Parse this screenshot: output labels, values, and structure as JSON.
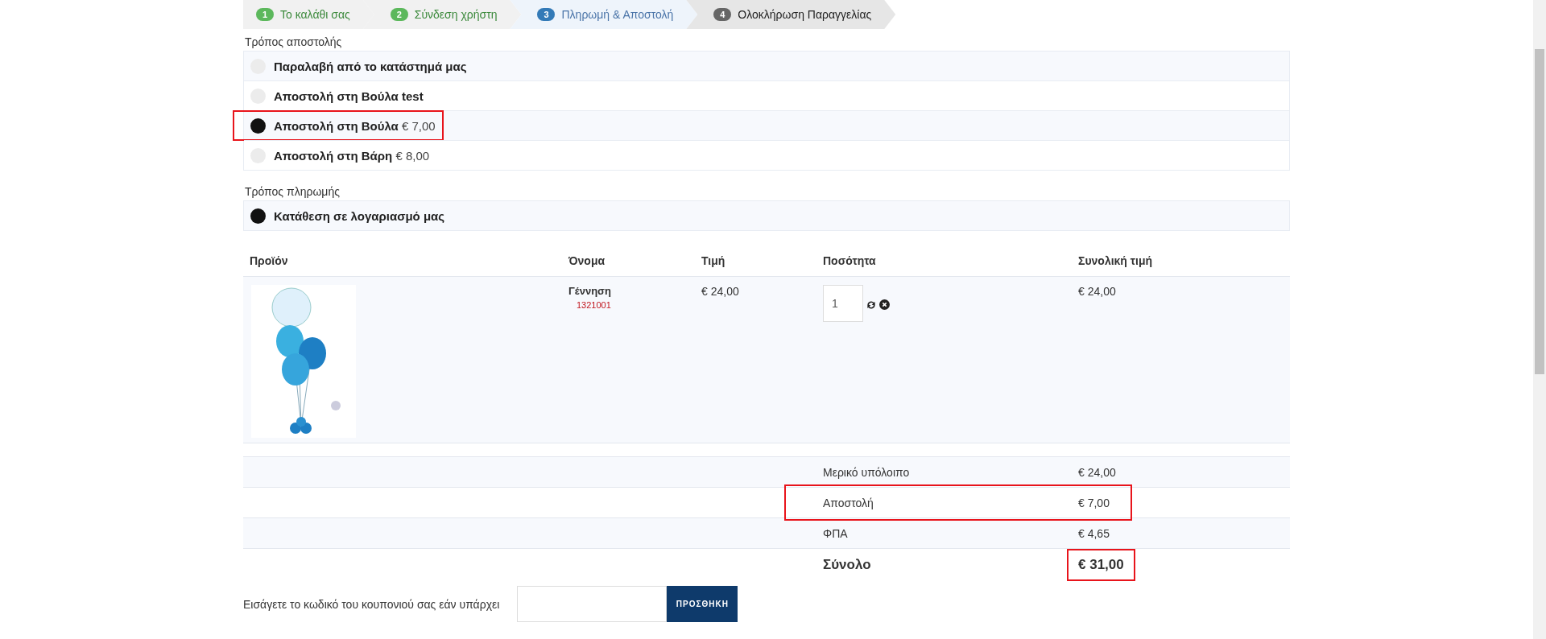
{
  "steps": [
    {
      "number": "1",
      "label": "Το καλάθι σας",
      "completed": true,
      "selected": false
    },
    {
      "number": "2",
      "label": "Σύνδεση χρήστη",
      "completed": true,
      "selected": false
    },
    {
      "number": "3",
      "label": "Πληρωμή & Αποστολή",
      "completed": false,
      "selected": true
    },
    {
      "number": "4",
      "label": "Ολοκλήρωση Παραγγελίας",
      "completed": false,
      "selected": false
    }
  ],
  "shipping": {
    "title": "Τρόπος αποστολής",
    "options": [
      {
        "label": "Παραλαβή από το κατάστημά μας",
        "selected": false,
        "highlighted": false
      },
      {
        "label": "Αποστολή στη Βούλα test",
        "selected": false,
        "highlighted": false
      },
      {
        "label": "Αποστολή στη Βούλα",
        "price": "€ 7,00",
        "selected": true,
        "highlighted": true
      },
      {
        "label": "Αποστολή στη Βάρη",
        "price": "€ 8,00",
        "selected": false,
        "highlighted": false
      }
    ]
  },
  "payment": {
    "title": "Τρόπος πληρωμής",
    "options": [
      {
        "label": "Κατάθεση σε λογαριασμό μας",
        "selected": true
      }
    ]
  },
  "table": {
    "columns": [
      "Προϊόν",
      "Όνομα",
      "Τιμή",
      "Ποσότητα",
      "Συνολική τιμή"
    ],
    "rows": [
      {
        "name": "Γέννηση",
        "sku": "1321001",
        "price": "€ 24,00",
        "quantity": "1",
        "total": "€ 24,00"
      }
    ]
  },
  "totals": [
    {
      "label": "Μερικό υπόλοιπο",
      "value": "€ 24,00",
      "kind": "normal",
      "highlighted": false
    },
    {
      "label": "Αποστολή",
      "value": "€ 7,00",
      "kind": "normal",
      "highlighted": true
    },
    {
      "label": "ΦΠΑ",
      "value": "€ 4,65",
      "kind": "normal",
      "highlighted": false
    },
    {
      "label": "Σύνολο",
      "value": "€ 31,00",
      "kind": "grand",
      "highlighted": true
    }
  ],
  "coupon": {
    "label": "Εισάγετε το κωδικό του κουπονιού σας εάν υπάρχει",
    "button": "ΠΡΟΣΘΗΚΗ"
  }
}
